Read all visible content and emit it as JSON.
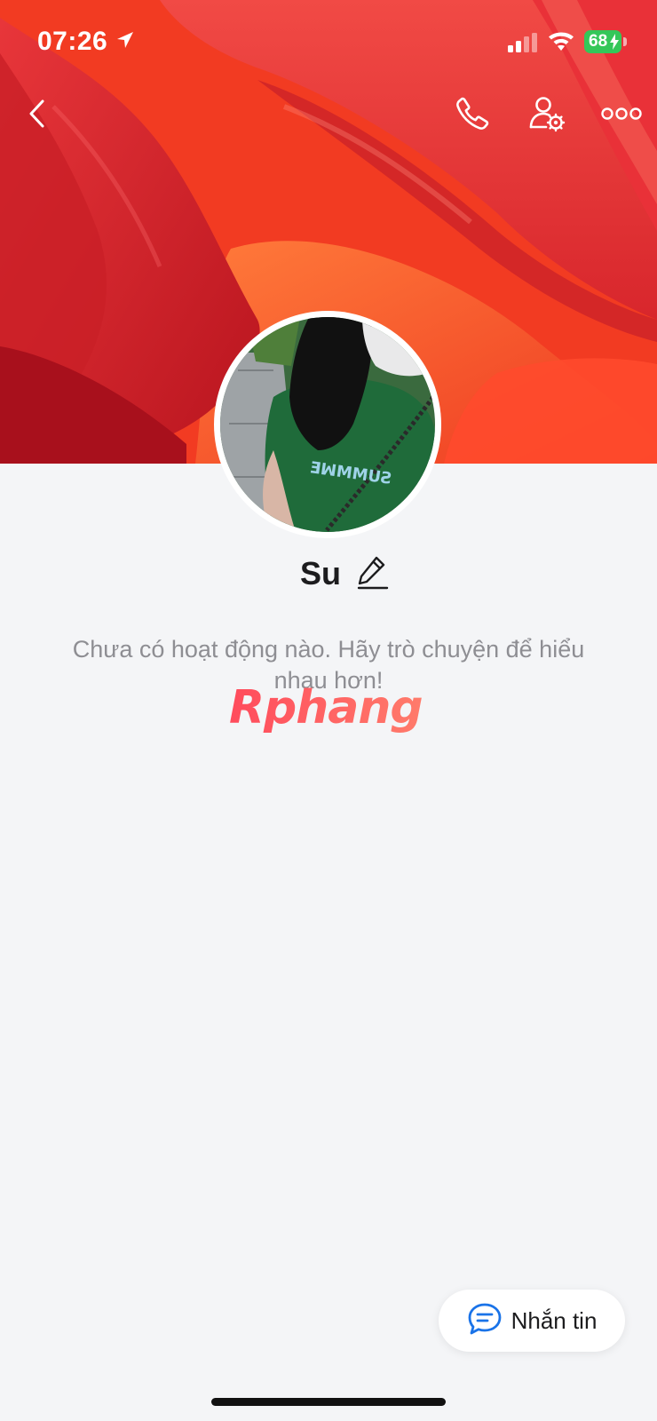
{
  "status_bar": {
    "time": "07:26",
    "battery_level": "68",
    "location_icon": "location-arrow-icon",
    "signal_icon": "cellular-signal-icon",
    "wifi_icon": "wifi-icon",
    "battery_icon": "battery-charging-icon"
  },
  "header": {
    "back_icon": "chevron-left-icon",
    "call_icon": "phone-icon",
    "profile_settings_icon": "user-settings-icon",
    "more_icon": "more-horizontal-icon"
  },
  "profile": {
    "name": "Su",
    "edit_icon": "pencil-icon",
    "empty_activity_message": "Chưa có hoạt động nào. Hãy trò chuyện để hiểu nhau hơn!"
  },
  "watermark": {
    "text": "Rphang"
  },
  "actions": {
    "message_label": "Nhắn tin",
    "message_icon": "chat-bubble-icon"
  },
  "colors": {
    "accent": "#1a73e8",
    "background": "#f4f5f7",
    "cover_red": "#f0331f",
    "text_primary": "#1c1c1e",
    "text_secondary": "#8e8e93",
    "battery_green": "#34c759"
  }
}
